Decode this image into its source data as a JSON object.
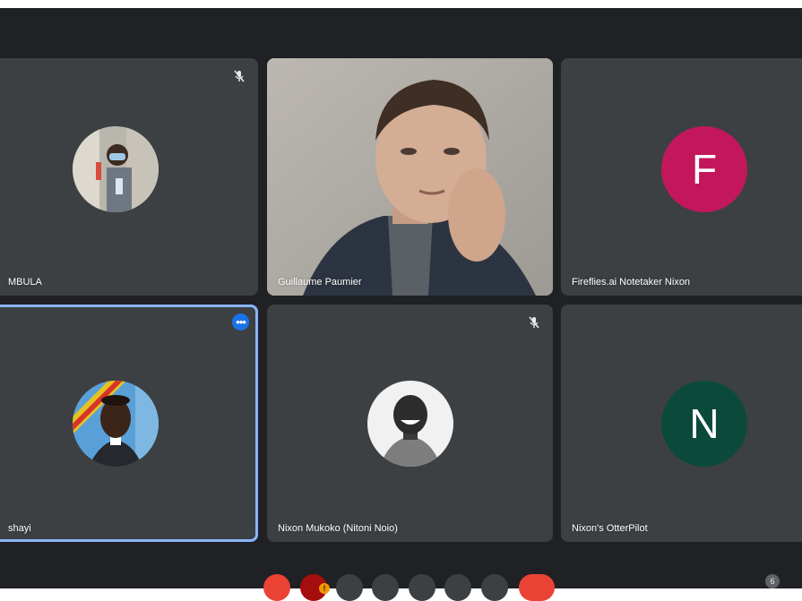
{
  "participants": [
    {
      "name": "MBULA",
      "muted": true,
      "type": "photo-avatar"
    },
    {
      "name": "Guillaume Paumier",
      "muted": false,
      "type": "video"
    },
    {
      "name": "Fireflies.ai Notetaker Nixon",
      "muted": false,
      "type": "letter-avatar",
      "letter": "F",
      "color": "#c2185b"
    },
    {
      "name": "shayi",
      "muted": false,
      "type": "photo-avatar",
      "speaking": true
    },
    {
      "name": "Nixon Mukoko (Nitoni Noio)",
      "muted": true,
      "type": "photo-avatar"
    },
    {
      "name": "Nixon's OtterPilot",
      "muted": false,
      "type": "letter-avatar",
      "letter": "N",
      "color": "#0b4a3a"
    }
  ],
  "controls": {
    "warning_badge": "!",
    "participant_count": "6"
  },
  "icons": [
    "mic-off-icon",
    "more-options-icon"
  ],
  "colors": {
    "background": "#202124",
    "tile": "#3c4043",
    "speaking_border": "#8ab4f8",
    "accent": "#1a73e8",
    "end_call": "#ea4335"
  }
}
